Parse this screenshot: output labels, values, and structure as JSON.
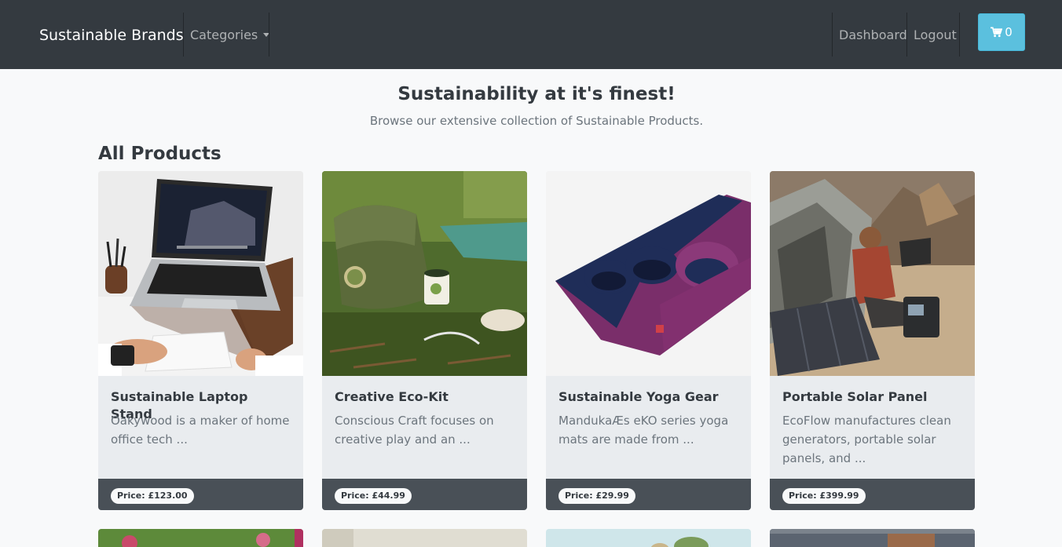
{
  "navbar": {
    "brand": "Sustainable Brands",
    "categories_label": "Categories",
    "dashboard_label": "Dashboard",
    "logout_label": "Logout",
    "cart_count": "0",
    "cart_icon": "shopping-cart-icon"
  },
  "hero": {
    "title": "Sustainability at it's finest!",
    "subtitle": "Browse our extensive collection of Sustainable Products."
  },
  "products_section": {
    "title": "All Products",
    "items": [
      {
        "name": "Sustainable Laptop Stand",
        "description": "Oakywood is a maker of home office tech ...",
        "price": "Price: £123.00"
      },
      {
        "name": "Creative Eco-Kit",
        "description": "Conscious Craft focuses on creative play and an ...",
        "price": "Price: £44.99"
      },
      {
        "name": "Sustainable Yoga Gear",
        "description": "MandukaÆs eKO series yoga mats are made from ...",
        "price": "Price: £29.99"
      },
      {
        "name": "Portable Solar Panel",
        "description": "EcoFlow manufactures clean generators, portable solar panels, and ...",
        "price": "Price: £399.99"
      }
    ]
  },
  "colors": {
    "navbar_bg": "#343a40",
    "cart_button": "#5bc0de",
    "card_bg": "#e9ecef",
    "card_footer": "#495057",
    "page_bg": "#f8f9fa"
  }
}
